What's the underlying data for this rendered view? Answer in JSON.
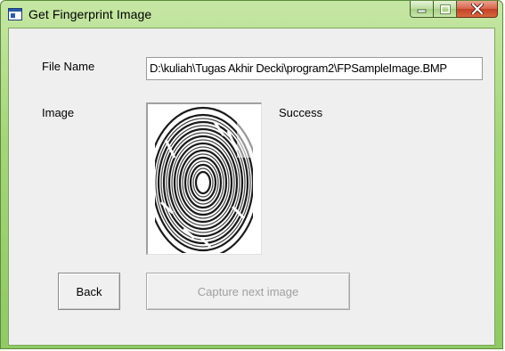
{
  "window": {
    "title": "Get Fingerprint Image",
    "accent": "#90c965",
    "close_color": "#c3412a"
  },
  "form": {
    "file_name_label": "File Name",
    "file_path_value": "D:\\kuliah\\Tugas Akhir Decki\\program2\\FPSampleImage.BMP",
    "image_label": "Image",
    "status_text": "Success"
  },
  "buttons": {
    "back_label": "Back",
    "capture_next_label": "Capture next image"
  },
  "icons": {
    "app": "window-app-icon",
    "minimize": "minimize-icon",
    "maximize": "maximize-icon",
    "close": "close-icon"
  }
}
